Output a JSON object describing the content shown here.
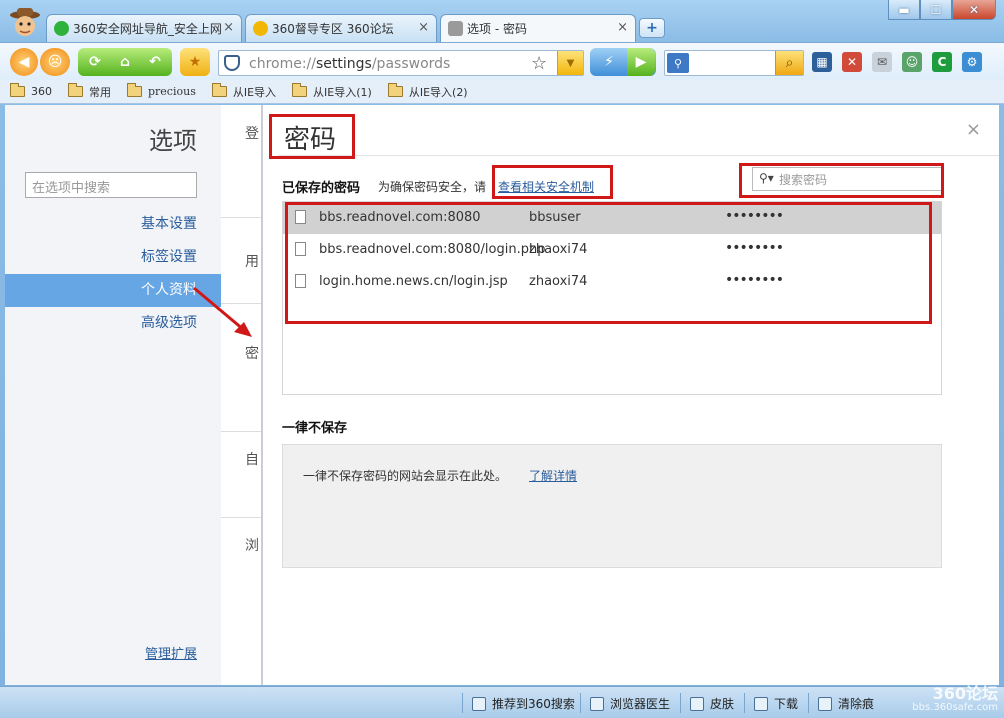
{
  "tabs": [
    {
      "title": "360安全网址导航_安全上网",
      "close": "×",
      "icon_color": "#2fb23c"
    },
    {
      "title": "360督导专区 360论坛",
      "close": "×",
      "icon_color": "#f2b705"
    },
    {
      "title": "选项 - 密码",
      "close": "×",
      "icon_color": "#7a7a7a"
    }
  ],
  "new_tab": "+",
  "window_buttons": {
    "minimize": "▬",
    "maximize": "☐",
    "close": "✕"
  },
  "toolbar": {
    "address_prefix": "chrome://",
    "address_host": "settings",
    "address_path": "/passwords",
    "star": "☆",
    "search_engine_icon": "search-icon",
    "go": "⌕"
  },
  "bookmarks": [
    "360",
    "常用",
    "precious",
    "从IE导入",
    "从IE导入(1)",
    "从IE导入(2)"
  ],
  "left_nav": {
    "title": "选项",
    "search_placeholder": "在选项中搜索",
    "items": [
      "基本设置",
      "标签设置",
      "个人资料",
      "高级选项"
    ],
    "selected_index": 2,
    "extensions": "管理扩展"
  },
  "gutter_labels": [
    "登",
    "用",
    "密",
    "自",
    "浏"
  ],
  "dialog": {
    "title": "密码",
    "close": "×",
    "saved_heading": "已保存的密码",
    "safety_text": "为确保密码安全，请",
    "safety_link": "查看相关安全机制",
    "search_placeholder": "搜索密码",
    "passwords": [
      {
        "site": "bbs.readnovel.com:8080",
        "user": "bbsuser",
        "password": "••••••••"
      },
      {
        "site": "bbs.readnovel.com:8080/login.php",
        "user": "zhaoxi74",
        "password": "••••••••"
      },
      {
        "site": "login.home.news.cn/login.jsp",
        "user": "zhaoxi74",
        "password": "••••••••"
      }
    ],
    "never_heading": "一律不保存",
    "never_text": "一律不保存密码的网站会显示在此处。",
    "never_link": "了解详情"
  },
  "status_bar": [
    "推荐到360搜索",
    "浏览器医生",
    "皮肤",
    "下载",
    "清除痕"
  ],
  "watermark": {
    "line1": "360论坛",
    "line2": "bbs.360safe.com"
  },
  "colors": {
    "accent": "#66a6e4",
    "annotation": "#d01818",
    "link": "#2a5d9c"
  }
}
